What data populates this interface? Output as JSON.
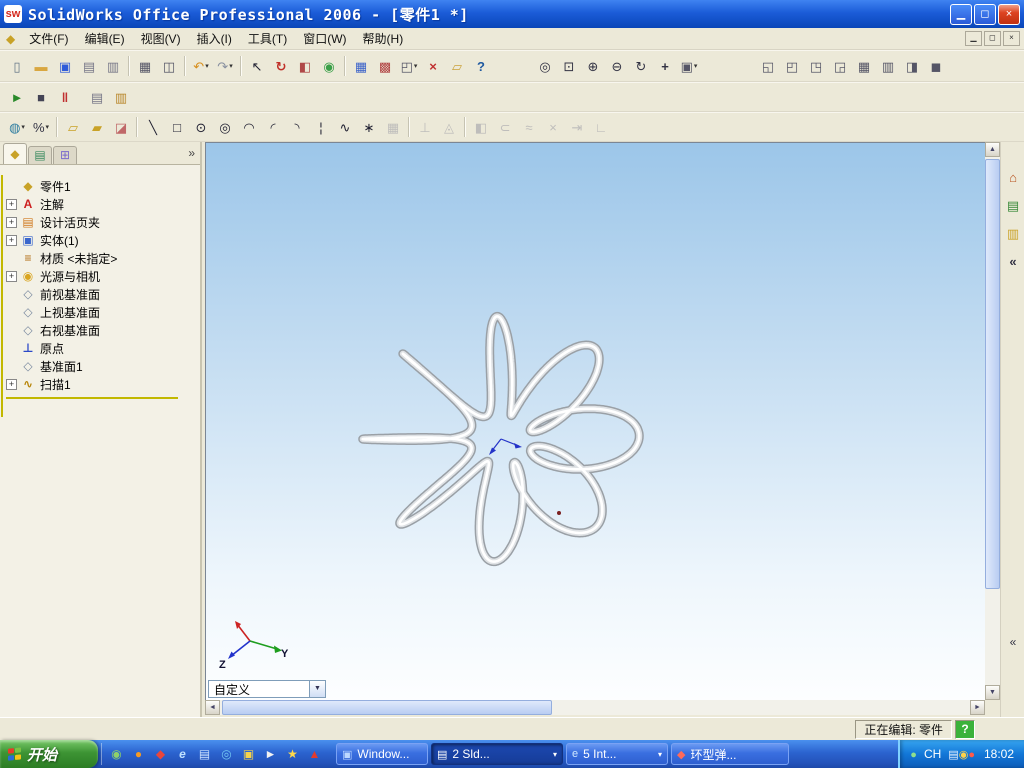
{
  "window": {
    "logo_text": "sw",
    "title": "SolidWorks Office Professional 2006 - [零件1 *]",
    "controls": {
      "minimize": "▁",
      "maximize": "◻",
      "close": "×"
    },
    "mdi_controls": {
      "minimize": "▁",
      "restore": "◻",
      "close": "×"
    }
  },
  "menu": {
    "app_icon_glyph": "◆",
    "items": [
      "文件(F)",
      "编辑(E)",
      "视图(V)",
      "插入(I)",
      "工具(T)",
      "窗口(W)",
      "帮助(H)"
    ]
  },
  "toolbars": {
    "dropdown_glyph": "▾",
    "standard": [
      {
        "name": "new-document-icon",
        "glyph": "▯",
        "color": "#667788"
      },
      {
        "name": "open-document-icon",
        "glyph": "▬",
        "color": "#d9a741"
      },
      {
        "name": "save-icon",
        "glyph": "▣",
        "color": "#2f5bd9"
      },
      {
        "name": "make-drawing-icon",
        "glyph": "▤",
        "color": "#778"
      },
      {
        "name": "make-assembly-icon",
        "glyph": "▥",
        "color": "#778"
      },
      {
        "sep": true
      },
      {
        "name": "print-icon",
        "glyph": "▦",
        "color": "#556"
      },
      {
        "name": "print-preview-icon",
        "glyph": "◫",
        "color": "#556"
      },
      {
        "sep": true
      },
      {
        "name": "undo-icon",
        "glyph": "↶",
        "color": "#d78f1e",
        "dd": true
      },
      {
        "name": "redo-icon",
        "glyph": "↷",
        "color": "#8890a0",
        "dd": true
      },
      {
        "sep": true
      },
      {
        "name": "select-icon",
        "glyph": "↖",
        "color": "#223"
      },
      {
        "name": "rebuild-icon",
        "glyph": "↻",
        "color": "#c03028",
        "bold": true
      },
      {
        "name": "edit-color-icon",
        "glyph": "◧",
        "color": "#b04848"
      },
      {
        "name": "appearance-icon",
        "glyph": "◉",
        "color": "#3aa048"
      },
      {
        "sep": true
      },
      {
        "name": "grid-icon",
        "glyph": "▦",
        "color": "#3b62c9"
      },
      {
        "name": "dimension-standard-icon",
        "glyph": "▩",
        "color": "#b04040"
      },
      {
        "name": "view-orientation-icon",
        "glyph": "◰",
        "color": "#556",
        "dd": true
      },
      {
        "name": "selection-filter-icon",
        "glyph": "×",
        "color": "#c03030",
        "bold": true
      },
      {
        "name": "annotation-icon",
        "glyph": "▱",
        "color": "#caa23a"
      },
      {
        "name": "help-icon",
        "glyph": "?",
        "color": "#205aa0",
        "bold": true
      },
      {
        "gap": 40
      },
      {
        "name": "zoom-fit-icon",
        "glyph": "◎",
        "color": "#334"
      },
      {
        "name": "zoom-area-icon",
        "glyph": "⊡",
        "color": "#334"
      },
      {
        "name": "zoom-in-out-icon",
        "glyph": "⊕",
        "color": "#334"
      },
      {
        "name": "zoom-selection-icon",
        "glyph": "⊖",
        "color": "#334"
      },
      {
        "name": "rotate-view-icon",
        "glyph": "↻",
        "color": "#334"
      },
      {
        "name": "pan-icon",
        "glyph": "+",
        "color": "#334",
        "bold": true
      },
      {
        "name": "standard-views-icon",
        "glyph": "▣",
        "color": "#556",
        "dd": true
      },
      {
        "gap": 55
      },
      {
        "name": "new-window-icon",
        "glyph": "◱",
        "color": "#556"
      },
      {
        "name": "tile-horizontal-icon",
        "glyph": "◰",
        "color": "#556"
      },
      {
        "name": "tile-vertical-icon",
        "glyph": "◳",
        "color": "#556"
      },
      {
        "name": "cascade-windows-icon",
        "glyph": "◲",
        "color": "#556"
      },
      {
        "name": "arrange-icons-icon",
        "glyph": "▦",
        "color": "#556"
      },
      {
        "name": "close-all-icon",
        "glyph": "▥",
        "color": "#556"
      },
      {
        "name": "toolbars-icon",
        "glyph": "◨",
        "color": "#556"
      },
      {
        "name": "fullscreen-icon",
        "glyph": "◼",
        "color": "#556"
      }
    ],
    "macro": [
      {
        "name": "play-macro-icon",
        "glyph": "►",
        "color": "#2a8a2a"
      },
      {
        "name": "stop-macro-icon",
        "glyph": "■",
        "color": "#445"
      },
      {
        "name": "pause-macro-icon",
        "glyph": "‖",
        "color": "#c03030",
        "bold": true
      },
      {
        "gap": 8
      },
      {
        "name": "new-macro-icon",
        "glyph": "▤",
        "color": "#778"
      },
      {
        "name": "edit-macro-icon",
        "glyph": "▥",
        "color": "#b8862a"
      }
    ],
    "sketch": [
      {
        "name": "sketch-icon",
        "glyph": "◍",
        "color": "#2e7da0",
        "dd": true
      },
      {
        "name": "smart-dimension-icon",
        "glyph": "%",
        "color": "#334",
        "dd": true
      },
      {
        "sep": true
      },
      {
        "name": "sketch-edit-icon",
        "glyph": "▱",
        "color": "#c9a227"
      },
      {
        "name": "sketch-modify-icon",
        "glyph": "▰",
        "color": "#c9a227"
      },
      {
        "name": "eraser-icon",
        "glyph": "◪",
        "color": "#c06868"
      },
      {
        "sep": true
      },
      {
        "name": "line-tool-icon",
        "glyph": "╲",
        "color": "#223"
      },
      {
        "name": "rectangle-tool-icon",
        "glyph": "□",
        "color": "#223"
      },
      {
        "name": "circle-tool-icon",
        "glyph": "⊙",
        "color": "#223"
      },
      {
        "name": "perimeter-circle-icon",
        "glyph": "◎",
        "color": "#223"
      },
      {
        "name": "centerpoint-arc-icon",
        "glyph": "◠",
        "color": "#223"
      },
      {
        "name": "tangent-arc-icon",
        "glyph": "◜",
        "color": "#223"
      },
      {
        "name": "three-point-arc-icon",
        "glyph": "◝",
        "color": "#223"
      },
      {
        "name": "centerline-icon",
        "glyph": "¦",
        "color": "#223"
      },
      {
        "name": "spline-tool-icon",
        "glyph": "∿",
        "color": "#223"
      },
      {
        "name": "point-tool-icon",
        "glyph": "∗",
        "color": "#223"
      },
      {
        "name": "linear-pattern-icon",
        "glyph": "▦",
        "color": "#889",
        "disabled": true
      },
      {
        "sep": true
      },
      {
        "name": "add-relation-icon",
        "glyph": "⊥",
        "color": "#889",
        "disabled": true
      },
      {
        "name": "display-relations-icon",
        "glyph": "◬",
        "color": "#889",
        "disabled": true
      },
      {
        "sep": true
      },
      {
        "name": "mirror-entities-icon",
        "glyph": "◧",
        "color": "#889",
        "disabled": true
      },
      {
        "name": "convert-entities-icon",
        "glyph": "⊂",
        "color": "#889",
        "disabled": true
      },
      {
        "name": "offset-entities-icon",
        "glyph": "≈",
        "color": "#889",
        "disabled": true
      },
      {
        "name": "trim-entities-icon",
        "glyph": "×",
        "color": "#889",
        "disabled": true
      },
      {
        "name": "extend-entities-icon",
        "glyph": "⇥",
        "color": "#889",
        "disabled": true
      },
      {
        "name": "jog-line-icon",
        "glyph": "∟",
        "color": "#889",
        "disabled": true
      }
    ]
  },
  "feature_panel": {
    "tabs": [
      {
        "name": "featuremanager-tab",
        "glyph": "◆",
        "color": "#c8a227"
      },
      {
        "name": "propertymanager-tab",
        "glyph": "▤",
        "color": "#3a8a5f"
      },
      {
        "name": "configurationmanager-tab",
        "glyph": "⊞",
        "color": "#7a6acc"
      }
    ],
    "collapse_glyph": "»",
    "expander_glyph": "+",
    "root_label": "零件1",
    "root_icon": {
      "glyph": "◆",
      "color": "#c8a227"
    },
    "items": [
      {
        "label": "注解",
        "plus": true,
        "icon": {
          "name": "annotations-icon",
          "glyph": "A",
          "color": "#cc2020"
        }
      },
      {
        "label": "设计活页夹",
        "plus": true,
        "icon": {
          "name": "design-binder-icon",
          "glyph": "▤",
          "color": "#d07a20"
        }
      },
      {
        "label": "实体(1)",
        "plus": true,
        "icon": {
          "name": "solid-bodies-icon",
          "glyph": "▣",
          "color": "#3a66cc"
        }
      },
      {
        "label": "材质 <未指定>",
        "plus": false,
        "icon": {
          "name": "material-icon",
          "glyph": "≡",
          "color": "#b06a10"
        }
      },
      {
        "label": "光源与相机",
        "plus": true,
        "icon": {
          "name": "lights-cameras-icon",
          "glyph": "◉",
          "color": "#d9a520"
        }
      },
      {
        "label": "前视基准面",
        "plus": false,
        "icon": {
          "name": "front-plane-icon",
          "glyph": "◇",
          "color": "#7a8aa0"
        }
      },
      {
        "label": "上视基准面",
        "plus": false,
        "icon": {
          "name": "top-plane-icon",
          "glyph": "◇",
          "color": "#7a8aa0"
        }
      },
      {
        "label": "右视基准面",
        "plus": false,
        "icon": {
          "name": "right-plane-icon",
          "glyph": "◇",
          "color": "#7a8aa0"
        }
      },
      {
        "label": "原点",
        "plus": false,
        "icon": {
          "name": "origin-icon",
          "glyph": "⊥",
          "color": "#2a48c8"
        }
      },
      {
        "label": "基准面1",
        "plus": false,
        "icon": {
          "name": "plane1-icon",
          "glyph": "◇",
          "color": "#7a8aa0"
        }
      },
      {
        "label": "扫描1",
        "plus": true,
        "icon": {
          "name": "sweep-icon",
          "glyph": "∿",
          "color": "#b8860b"
        }
      }
    ]
  },
  "viewport": {
    "model": {
      "type": "toroidal-spring",
      "loops": 8,
      "tube_colors": [
        "#9aa0a6",
        "#dfe2e5",
        "#ffffff"
      ]
    },
    "triad": {
      "y_label": "Y",
      "z_label": "Z",
      "x_color": "#cc2222",
      "y_color": "#1f9e1f",
      "z_color": "#2233cc"
    },
    "view_selector": {
      "value": "自定义",
      "arrow": "▼"
    }
  },
  "scrollbars": {
    "up": "▲",
    "down": "▼",
    "left": "◄",
    "right": "►"
  },
  "task_pane": {
    "icons": [
      {
        "name": "home-icon",
        "glyph": "⌂",
        "color": "#b8521e"
      },
      {
        "name": "design-library-icon",
        "glyph": "▤",
        "color": "#3a8a3a"
      },
      {
        "name": "file-explorer-icon",
        "glyph": "▥",
        "color": "#caa32a"
      },
      {
        "name": "collapse-chevron-icon",
        "glyph": "«",
        "color": "#334"
      }
    ],
    "bottom_chevron": "«"
  },
  "statusbar": {
    "editing_label": "正在编辑: 零件",
    "help_glyph": "?"
  },
  "taskbar": {
    "start_label": "开始",
    "flag_colors": [
      "#e83b28",
      "#7bc143",
      "#2a6cd8",
      "#f5c318"
    ],
    "quick_launch": [
      {
        "name": "quick-launch-messenger-icon",
        "glyph": "◉",
        "color": "#8ed06a"
      },
      {
        "name": "quick-launch-media-icon",
        "glyph": "●",
        "color": "#f59a23"
      },
      {
        "name": "quick-launch-qq-icon",
        "glyph": "◆",
        "color": "#e8463c"
      },
      {
        "name": "quick-launch-ie-icon",
        "glyph": "e",
        "color": "#bfe1ff",
        "bold": true
      },
      {
        "name": "quick-launch-desktop-icon",
        "glyph": "▤",
        "color": "#cfe3ff"
      },
      {
        "name": "quick-launch-browser-icon",
        "glyph": "◎",
        "color": "#74c7f2"
      },
      {
        "name": "quick-launch-mail-icon",
        "glyph": "▣",
        "color": "#f5d34a"
      },
      {
        "name": "quick-launch-player-icon",
        "glyph": "►",
        "color": "#f2f2f2"
      },
      {
        "name": "quick-launch-star-icon",
        "glyph": "★",
        "color": "#ffd94a"
      },
      {
        "name": "quick-launch-solidworks-icon",
        "glyph": "▲",
        "color": "#e23b2e"
      }
    ],
    "tasks": [
      {
        "label": "Window...",
        "icon_glyph": "▣",
        "icon_color": "#bcd8ff",
        "active": false,
        "dropdown": false
      },
      {
        "label": "2 Sld...",
        "icon_glyph": "▤",
        "icon_color": "#ffffff",
        "active": true,
        "dropdown": true
      },
      {
        "label": "5 Int...",
        "icon_glyph": "e",
        "icon_color": "#cfe8ff",
        "active": false,
        "dropdown": true
      },
      {
        "label": "环型弹...",
        "icon_glyph": "◆",
        "icon_color": "#ff6a5a",
        "active": false,
        "dropdown": false
      }
    ],
    "tray": {
      "icons_left": [
        {
          "name": "tray-messenger-icon",
          "glyph": "●",
          "color": "#8ee08e"
        }
      ],
      "lang": "CH",
      "icons_right": [
        {
          "name": "tray-input-icon",
          "glyph": "▤",
          "color": "#eef4ff"
        },
        {
          "name": "tray-volume-icon",
          "glyph": "◉",
          "color": "#ffd24a"
        },
        {
          "name": "tray-security-icon",
          "glyph": "●",
          "color": "#ff5a4a"
        }
      ],
      "time": "18:02"
    }
  }
}
